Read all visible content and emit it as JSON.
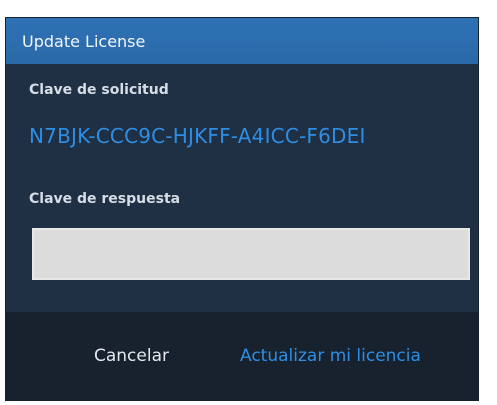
{
  "dialog": {
    "title": "Update License"
  },
  "request": {
    "label": "Clave de solicitud",
    "key": "N7BJK-CCC9C-HJKFF-A4ICC-F6DEI"
  },
  "response": {
    "label": "Clave de respuesta",
    "value": "",
    "placeholder": ""
  },
  "buttons": {
    "cancel": "Cancelar",
    "update": "Actualizar mi licencia"
  },
  "colors": {
    "accent": "#2d8ee4",
    "titlebar": "#2e72b5",
    "panel": "#1f2f44",
    "footer": "#18222f"
  }
}
